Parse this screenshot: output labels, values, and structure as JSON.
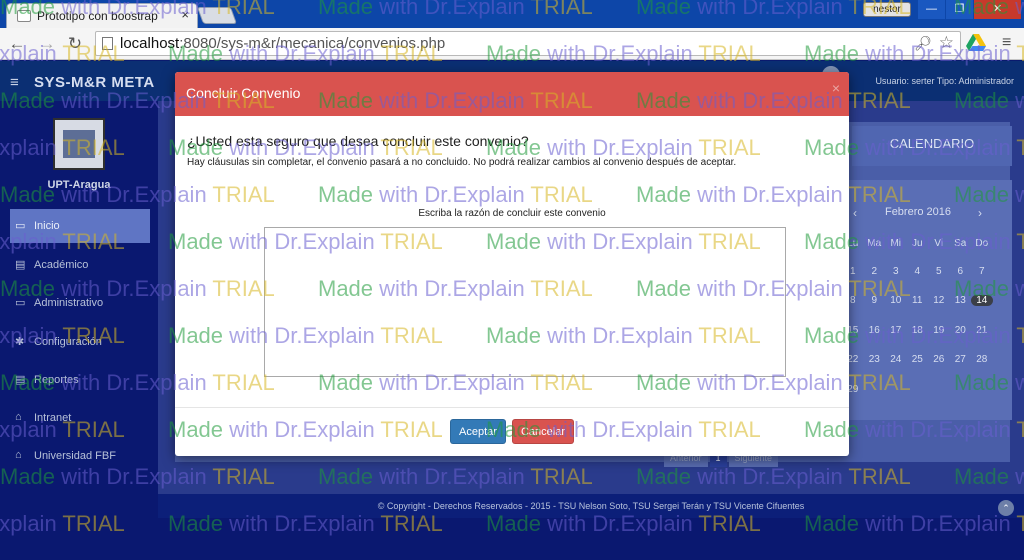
{
  "browser": {
    "tab_title": "Prototipo con boostrap",
    "tab_close": "×",
    "user_badge": "nestor",
    "window_min": "—",
    "window_max": "❐",
    "window_close": "✕",
    "back": "←",
    "forward": "→",
    "reload": "↻",
    "url_host": "localhost",
    "url_rest": ":8080/sys-m&r/mecanica/convenios.php",
    "menu_icon": "≡"
  },
  "app": {
    "hamburger": "≡",
    "brand": "SYS-M&R   META",
    "userinfo": "Usuario: serter   Tipo: Administrador",
    "sidebar_title": "UPT-Aragua",
    "sidebar_items": [
      {
        "icon": "▭",
        "label": "Inicio"
      },
      {
        "icon": "▤",
        "label": "Académico"
      },
      {
        "icon": "▭",
        "label": "Administrativo"
      },
      {
        "icon": "✱",
        "label": "Configuración"
      },
      {
        "icon": "▤",
        "label": "Reportes"
      },
      {
        "icon": "⌂",
        "label": "Intranet"
      },
      {
        "icon": "⌂",
        "label": "Universidad FBF"
      }
    ],
    "calendar": {
      "header": "CALENDARIO",
      "month": "Febrero 2016",
      "prev": "‹",
      "next": "›",
      "weekdays": [
        "Lu",
        "Ma",
        "Mi",
        "Ju",
        "Vi",
        "Sa",
        "Do"
      ],
      "rows": [
        [
          "1",
          "2",
          "3",
          "4",
          "5",
          "6",
          "7"
        ],
        [
          "8",
          "9",
          "10",
          "11",
          "12",
          "13",
          "14"
        ],
        [
          "15",
          "16",
          "17",
          "18",
          "19",
          "20",
          "21"
        ],
        [
          "22",
          "23",
          "24",
          "25",
          "26",
          "27",
          "28"
        ],
        [
          "29",
          "",
          "",
          "",
          "",
          "",
          ""
        ]
      ],
      "today": "14"
    },
    "pager": {
      "prev": "Anterior",
      "current": "1",
      "next": "Siguiente"
    },
    "footer": "© Copyright - Derechos Reservados - 2015 - TSU Nelson Soto, TSU Sergei Terán y TSU Vicente Cifuentes",
    "scroll_top": "⌃"
  },
  "modal": {
    "title": "Concluir Convenio",
    "close": "×",
    "question": "¿Usted esta seguro que desea concluir este convenio?",
    "warning": "Hay cláusulas sin completar, el convenio pasará a no concluido. No podrá realizar cambios al convenio después de aceptar.",
    "reason_label": "Escriba la razón de concluir este convenio",
    "reason_value": "",
    "accept": "Aceptar",
    "cancel": "Cancelar"
  },
  "watermark": {
    "part1": "Made",
    "part2": "with Dr.Explain",
    "part3": "TRIAL"
  },
  "colors": {
    "modal_header": "#d9534f",
    "accept_button": "#337ab7",
    "cancel_button": "#d9534f"
  }
}
